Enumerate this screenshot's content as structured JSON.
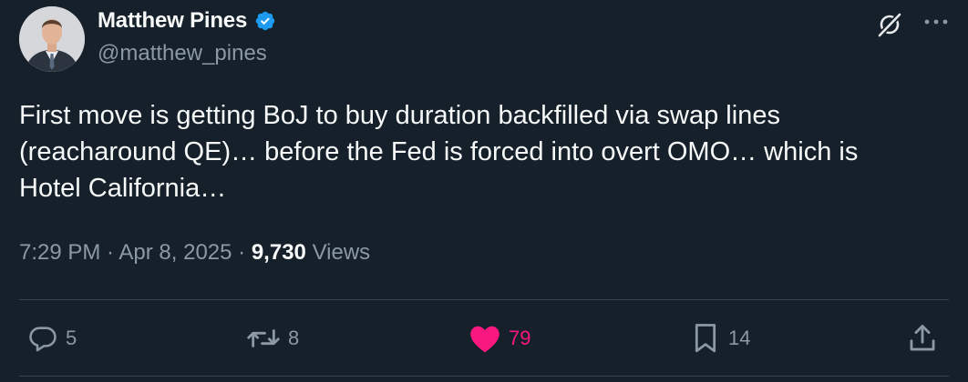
{
  "author": {
    "display_name": "Matthew Pines",
    "handle": "@matthew_pines",
    "verified": true,
    "verified_color": "#1d9bf0"
  },
  "tweet": {
    "text": "First move is getting BoJ to buy duration backfilled via swap lines\n(reacharound QE)… before the Fed is forced into overt OMO… which is\nHotel California…",
    "time": "7:29 PM",
    "separator": " · ",
    "date": "Apr 8, 2025",
    "views_count": "9,730",
    "views_label": "Views"
  },
  "actions": {
    "reply": {
      "icon": "reply-icon",
      "count": "5"
    },
    "repost": {
      "icon": "repost-icon",
      "count": "8"
    },
    "like": {
      "icon": "heart-icon",
      "count": "79",
      "liked": true,
      "color": "#f91880"
    },
    "bookmark": {
      "icon": "bookmark-icon",
      "count": "14"
    },
    "share": {
      "icon": "share-icon"
    }
  },
  "colors": {
    "background": "#15202b",
    "text_primary": "#f7f9f9",
    "text_secondary": "#8b98a5",
    "divider": "#38444d"
  }
}
